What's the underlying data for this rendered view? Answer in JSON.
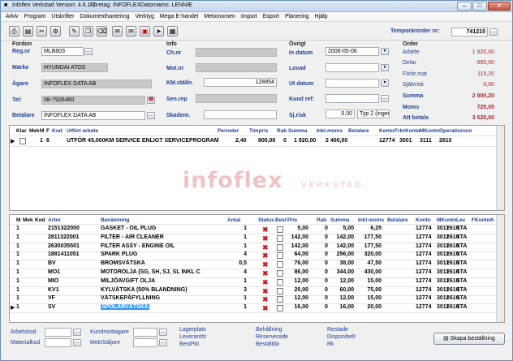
{
  "window": {
    "title_app": "Infoflex Verkstad Version: 4.6.1.2",
    "title_company": "Företag: INFOFLEX",
    "title_date": "Datornamn: LENNIE"
  },
  "menu": [
    "Arkiv",
    "Program",
    "Utskrifter",
    "Dokumenthantering",
    "Verktyg",
    "Mega E-handel",
    "Mekonomen",
    "Import",
    "Export",
    "Planering",
    "Hjälp"
  ],
  "toolbar_icons": [
    "print-icon",
    "new-document-icon",
    "tools-icon",
    "settings-icon",
    "edit-icon",
    "copy-icon",
    "delete-icon",
    "mail-icon",
    "mail-open-icon",
    "pdf-icon",
    "send-icon",
    "report-icon"
  ],
  "temp_order": {
    "label": "Temporärorder nr:",
    "value": "741215"
  },
  "fordon": {
    "heading": "Fordon",
    "regnr_label": "Reg.nr",
    "regnr": "MLB803",
    "marke_label": "Märke",
    "marke": "HYUNDAI ATOS",
    "agare_label": "Ägare",
    "agare": "INFOFLEX DATA AB",
    "tel_label": "Tel:",
    "tel": "08-7926460",
    "betalare_label": "Betalare",
    "betalare": "INFOFLEX DATA AB"
  },
  "info": {
    "heading": "Info",
    "chnr_label": "Ch.nr",
    "chnr": "",
    "motnr_label": "Mot.nr",
    "motnr": "",
    "km_label": "KM.ställn.",
    "km": "128854",
    "senrep_label": "Sen.rep",
    "senrep": "",
    "skadenr_label": "Skadenr.",
    "skadenr": ""
  },
  "ovrigt": {
    "heading": "Övrigt",
    "indatum_label": "In datum",
    "indatum": "2008-05-06",
    "lovad_label": "Lovad",
    "lovad": "",
    "utdatum_label": "Ut datum",
    "utdatum": "",
    "kundref_label": "Kund ref:",
    "kundref": "",
    "sjrisk_label": "Sj.risk",
    "sjrisk": "0,00",
    "typ": "Typ 2 (ingen"
  },
  "order": {
    "heading": "Order",
    "rows": [
      {
        "k": "Arbete",
        "v": "1 920,00"
      },
      {
        "k": "Delar",
        "v": "865,00"
      },
      {
        "k": "Förbr.mat",
        "v": "115,20"
      },
      {
        "k": "Självrisk",
        "v": "0,00"
      },
      {
        "k": "Summa",
        "v": "2 900,20"
      },
      {
        "k": "Moms",
        "v": "725,05"
      },
      {
        "k": "Att betala",
        "v": "3 625,00"
      }
    ]
  },
  "work_grid": {
    "headers": [
      "Klar",
      "Mek",
      "M",
      "F",
      "Kod",
      "Utfört arbete",
      "Perioder",
      "Timpris",
      "Rab",
      "Summa",
      "Inkl.moms",
      "Betalare",
      "Konto",
      "FrbrKonto",
      "MKonto",
      "Operationsnr"
    ],
    "rows": [
      {
        "klar": "",
        "mek": "1",
        "f": "6",
        "kod": "",
        "utfort": "UTFÖR 45,000KM SERVICE ENLIGT SERVICEPROGRAM",
        "perioder": "2,40",
        "timpris": "800,00",
        "rab": "0",
        "summa": "1 920,00",
        "inkl": "2 400,00",
        "betalare": "",
        "konto": "12774",
        "frbr": "3001",
        "mkonto": "3111",
        "op": "2610"
      }
    ]
  },
  "watermark": {
    "main": "infoflex",
    "sub": "VERKSTAD"
  },
  "parts_grid": {
    "headers": [
      "M",
      "Mek",
      "Kod",
      "Artnr",
      "Benämning",
      "Antal",
      "Status",
      "Best",
      "Pris",
      "Rab",
      "Summa",
      "Inkl.moms",
      "Betalare",
      "Konto",
      "MKonto",
      "Lev",
      "FKonto",
      "K"
    ],
    "rows": [
      {
        "m": "1",
        "artnr": "2151322000",
        "ben": "GASKET - OIL PLUG",
        "antal": "1",
        "pris": "5,00",
        "rab": "0",
        "summa": "5,00",
        "inkl": "6,25",
        "konto": "12774",
        "mk1": "3011",
        "mk2": "2610",
        "lev": "STA"
      },
      {
        "m": "1",
        "artnr": "2811322001",
        "ben": "FILTER - AIR CLEANER",
        "antal": "1",
        "pris": "142,00",
        "rab": "0",
        "summa": "142,00",
        "inkl": "177,50",
        "konto": "12774",
        "mk1": "3011",
        "mk2": "2610",
        "lev": "STA"
      },
      {
        "m": "1",
        "artnr": "2630035501",
        "ben": "FILTER ASSY - ENGINE OIL",
        "antal": "1",
        "pris": "142,00",
        "rab": "0",
        "summa": "142,00",
        "inkl": "177,50",
        "konto": "12774",
        "mk1": "3011",
        "mk2": "2610",
        "lev": "STA"
      },
      {
        "m": "1",
        "artnr": "1881411051",
        "ben": "SPARK PLUG",
        "antal": "4",
        "pris": "64,00",
        "rab": "0",
        "summa": "256,00",
        "inkl": "320,00",
        "konto": "12774",
        "mk1": "3011",
        "mk2": "2610",
        "lev": "STA"
      },
      {
        "m": "1",
        "artnr": "BV",
        "ben": "BROMSVÄTSKA",
        "antal": "0,5",
        "pris": "76,00",
        "rab": "0",
        "summa": "38,00",
        "inkl": "47,50",
        "konto": "12774",
        "mk1": "3011",
        "mk2": "2610",
        "lev": "STA"
      },
      {
        "m": "1",
        "artnr": "MO1",
        "ben": "MOTOROLJA (SG, SH, SJ, SL INKL C",
        "antal": "4",
        "pris": "86,00",
        "rab": "0",
        "summa": "344,00",
        "inkl": "430,00",
        "konto": "12774",
        "mk1": "3011",
        "mk2": "2610",
        "lev": "STA"
      },
      {
        "m": "1",
        "artnr": "MIO",
        "ben": "MILJÖAVGIFT OLJA",
        "antal": "1",
        "pris": "12,00",
        "rab": "0",
        "summa": "12,00",
        "inkl": "15,00",
        "konto": "12774",
        "mk1": "3011",
        "mk2": "2610",
        "lev": "STA"
      },
      {
        "m": "1",
        "artnr": "KV1",
        "ben": "KYLVÄTSKA (50% BLANDNING)",
        "antal": "3",
        "pris": "20,00",
        "rab": "0",
        "summa": "60,00",
        "inkl": "75,00",
        "konto": "12774",
        "mk1": "3011",
        "mk2": "2610",
        "lev": "STA"
      },
      {
        "m": "1",
        "artnr": "VF",
        "ben": "VÄTSKEPÅFYLLNING",
        "antal": "1",
        "pris": "12,00",
        "rab": "0",
        "summa": "12,00",
        "inkl": "15,00",
        "konto": "12774",
        "mk1": "3011",
        "mk2": "2610",
        "lev": "STA"
      },
      {
        "m": "1",
        "artnr": "SV",
        "ben": "SPOLARVÄTSKA",
        "antal": "1",
        "pris": "16,00",
        "rab": "0",
        "summa": "16,00",
        "inkl": "20,00",
        "konto": "12774",
        "mk1": "3011",
        "mk2": "2610",
        "lev": "STA"
      }
    ]
  },
  "footer": {
    "arbetskod": "Arbetskod",
    "materialkod": "Materialkod",
    "kundmottagare": "Kundmottagare",
    "mek_saljare": "Mek/Säljare",
    "links_col1": [
      "Lagerplats",
      "Leverantör",
      "BestPkt"
    ],
    "links_col2": [
      "Behållning",
      "Reserverade",
      "Beställda"
    ],
    "links_col3": [
      "Restade",
      "Disponibelt",
      "Rk"
    ],
    "save_button": "Skapa beställning"
  },
  "colors": {
    "accent": "#1d3f93",
    "value_red": "#a52a2a",
    "status_x": "#c0202a"
  }
}
